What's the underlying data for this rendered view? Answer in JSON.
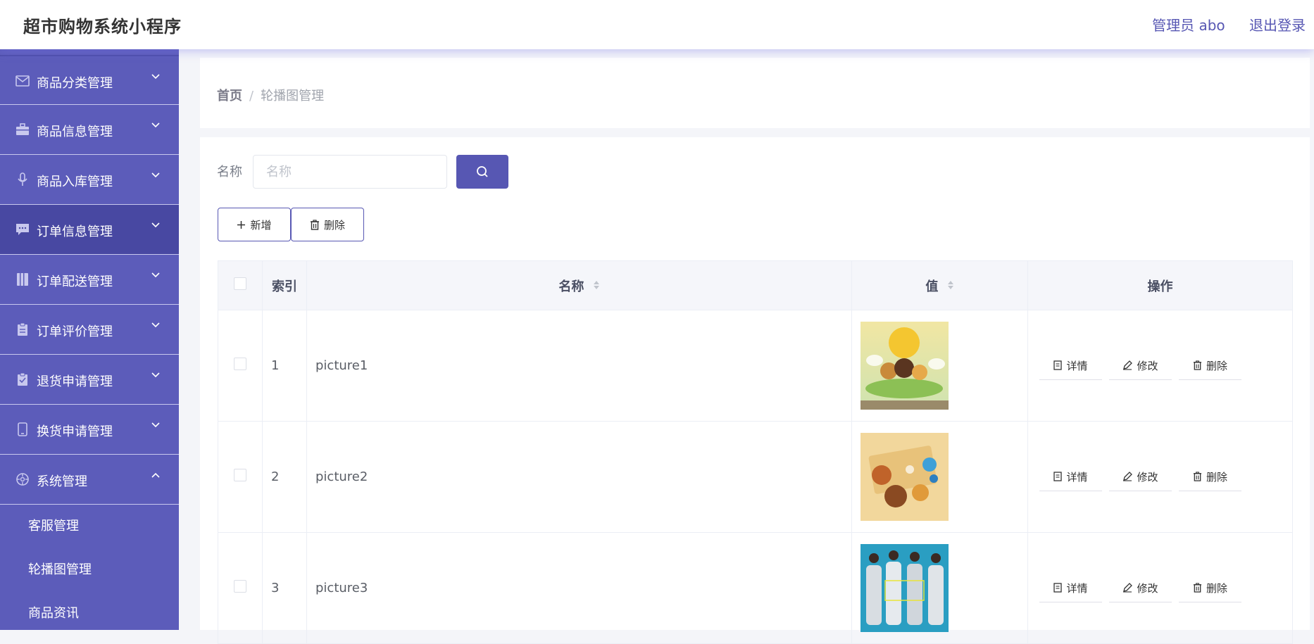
{
  "app": {
    "title": "超市购物系统小程序",
    "user_label": "管理员 abo",
    "logout_label": "退出登录"
  },
  "sidebar": {
    "items": [
      {
        "label": "商品分类管理",
        "icon": "mail-icon"
      },
      {
        "label": "商品信息管理",
        "icon": "briefcase-icon"
      },
      {
        "label": "商品入库管理",
        "icon": "microphone-icon"
      },
      {
        "label": "订单信息管理",
        "icon": "chat-icon"
      },
      {
        "label": "订单配送管理",
        "icon": "book-icon"
      },
      {
        "label": "订单评价管理",
        "icon": "clipboard-icon"
      },
      {
        "label": "退货申请管理",
        "icon": "clipboard-check-icon"
      },
      {
        "label": "换货申请管理",
        "icon": "phone-icon"
      },
      {
        "label": "系统管理",
        "icon": "compass-icon"
      }
    ],
    "sub_items": [
      {
        "label": "客服管理"
      },
      {
        "label": "轮播图管理"
      },
      {
        "label": "商品资讯"
      }
    ]
  },
  "breadcrumb": {
    "home": "首页",
    "separator": "/",
    "current": "轮播图管理"
  },
  "search": {
    "label": "名称",
    "placeholder": "名称"
  },
  "toolbar": {
    "add_label": "新增",
    "delete_label": "删除"
  },
  "table": {
    "headers": {
      "index": "索引",
      "name": "名称",
      "value": "值",
      "actions": "操作"
    },
    "rows": [
      {
        "index": "1",
        "name": "picture1"
      },
      {
        "index": "2",
        "name": "picture2"
      },
      {
        "index": "3",
        "name": "picture3"
      }
    ],
    "row_actions": {
      "detail": "详情",
      "edit": "修改",
      "delete": "删除"
    }
  },
  "colors": {
    "accent": "#5757b3",
    "sidebar": "#5c5cba",
    "sidebar_active": "#4848a2"
  }
}
